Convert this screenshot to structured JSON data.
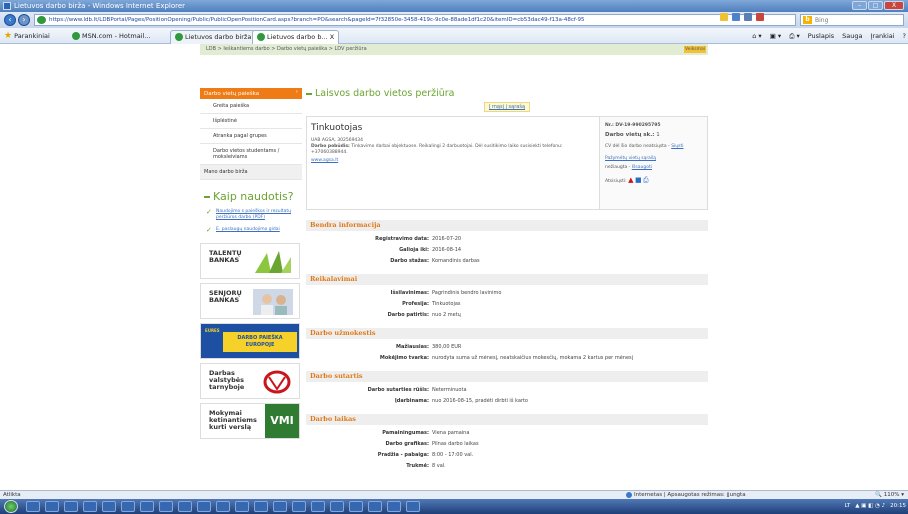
{
  "window": {
    "title": "Lietuvos darbo birža - Windows Internet Explorer",
    "buttons": {
      "minimize": "–",
      "maximize": "□",
      "close": "X"
    }
  },
  "address_bar": {
    "url": "https://www.ldb.lt/LDBPortal/Pages/PositionOpening/Public/PublicOpenPositionCard.aspx?branch=PO&search&pageId=7f32850e-3458-419c-9c0e-88ade1df1c20&itemID=cb53dac49-f13a-48cf-95",
    "search_placeholder": "Bing"
  },
  "favorites_bar": {
    "favorites": "Parankiniai",
    "msn": "MSN.com - Hotmail...",
    "tab1": "Lietuvos darbo birža",
    "tab2": "Lietuvos darbo b...",
    "tab_close": "X",
    "commands": [
      "Puslapis",
      "Sauga",
      "Įrankiai"
    ]
  },
  "breadcrumb": {
    "text": "LDB > Ieškantiems darbo > Darbo vietų paieška > LDV peržiūra",
    "tool": "Veiksmai"
  },
  "left_nav": {
    "header": "Darbo vietų paieška",
    "items": [
      "Greita paieška",
      "Išplėstinė",
      "Atranka pagal grupes",
      "Darbo vietos studentams / moksleiviams"
    ],
    "section2": "Mano darbo birža",
    "kaip_title": "Kaip naudotis?",
    "help_links": [
      "Naudojimo s paieškos ir rezultatų peržiūros darbo (PDF)",
      "E. paslaugų naudojimo gidai"
    ]
  },
  "banners": {
    "talentu": [
      "TALENTŲ",
      "BANKAS"
    ],
    "senjoru": [
      "SENJORŲ",
      "BANKAS"
    ],
    "eu": "DARBO PAIEŠKA EUROPOJE",
    "eures": "EURES",
    "vdt": [
      "Darbas",
      "valstybės",
      "tarnyboje"
    ],
    "vmi_text": [
      "Mokymai",
      "ketinantiems",
      "kurti verslą"
    ],
    "vmi_logo": "VMI"
  },
  "main": {
    "page_title": "Laisvos darbo vietos peržiūra",
    "back_link": "Į mąsį į sąrašą",
    "job": {
      "title": "Tinkuotojas",
      "company": "UAB AGSA, 302569434",
      "description_label": "Darbo pobūdis:",
      "description": "Tinkavimo darbai objektuose. Reikalingi 2 darbuotojai. Dėl susitikimo laiko susisiekti telefonu: +37060388944.",
      "website": "www.agsa.lt",
      "id_line": "Nr.: DV-19-990295795",
      "positions_label": "Darbo vietų sk.:",
      "positions": "1",
      "cv_line": "CV dėl šio darbo neatsiųsta -",
      "cv_link": "Siųsti",
      "remember_link": "Pažymėtų vietų sąrašą",
      "remember_status": "nežiaugta -",
      "remember_action": "Išsaugoti",
      "print_label": "Atsisiųsti:"
    },
    "sections": [
      {
        "title": "Bendra informacija",
        "rows": [
          {
            "k": "Registravimo data:",
            "v": "2016-07-20"
          },
          {
            "k": "Galioja iki:",
            "v": "2016-08-14"
          },
          {
            "k": "Darbo stažas:",
            "v": "Komandinis darbas"
          }
        ]
      },
      {
        "title": "Reikalavimai",
        "rows": [
          {
            "k": "Išsilavinimas:",
            "v": "Pagrindinis bendro lavinimo"
          },
          {
            "k": "Profesija:",
            "v": "Tinkuotojas"
          },
          {
            "k": "Darbo patirtis:",
            "v": "nuo 2 metų"
          }
        ]
      },
      {
        "title": "Darbo užmokestis",
        "rows": [
          {
            "k": "Mažiausias:",
            "v": "380,00 EUR"
          },
          {
            "k": "Mokėjimo tvarka:",
            "v": "nurodyta suma už mėnesį, neatskaičius mokesčių, mokama 2 kartus per mėnesį"
          }
        ]
      },
      {
        "title": "Darbo sutartis",
        "rows": [
          {
            "k": "Darbo sutarties rūšis:",
            "v": "Neterminuota"
          },
          {
            "k": "Įdarbinama:",
            "v": "nuo 2016-08-15, pradėti dirbti iš karto"
          }
        ]
      },
      {
        "title": "Darbo laikas",
        "rows": [
          {
            "k": "Pamainingumas:",
            "v": "Viena pamaina"
          },
          {
            "k": "Darbo grafikas:",
            "v": "Pilnas darbo laikas"
          },
          {
            "k": "Pradžia - pabaiga:",
            "v": "8:00 - 17:00 val."
          },
          {
            "k": "Trukmė:",
            "v": "8 val."
          }
        ]
      }
    ]
  },
  "status_bar": {
    "left": "Atlikta",
    "zone": "Internetas | Apsaugotas režimas: įjungta",
    "zoom": "110%"
  },
  "taskbar": {
    "lang": "LT",
    "time": "20:15"
  }
}
